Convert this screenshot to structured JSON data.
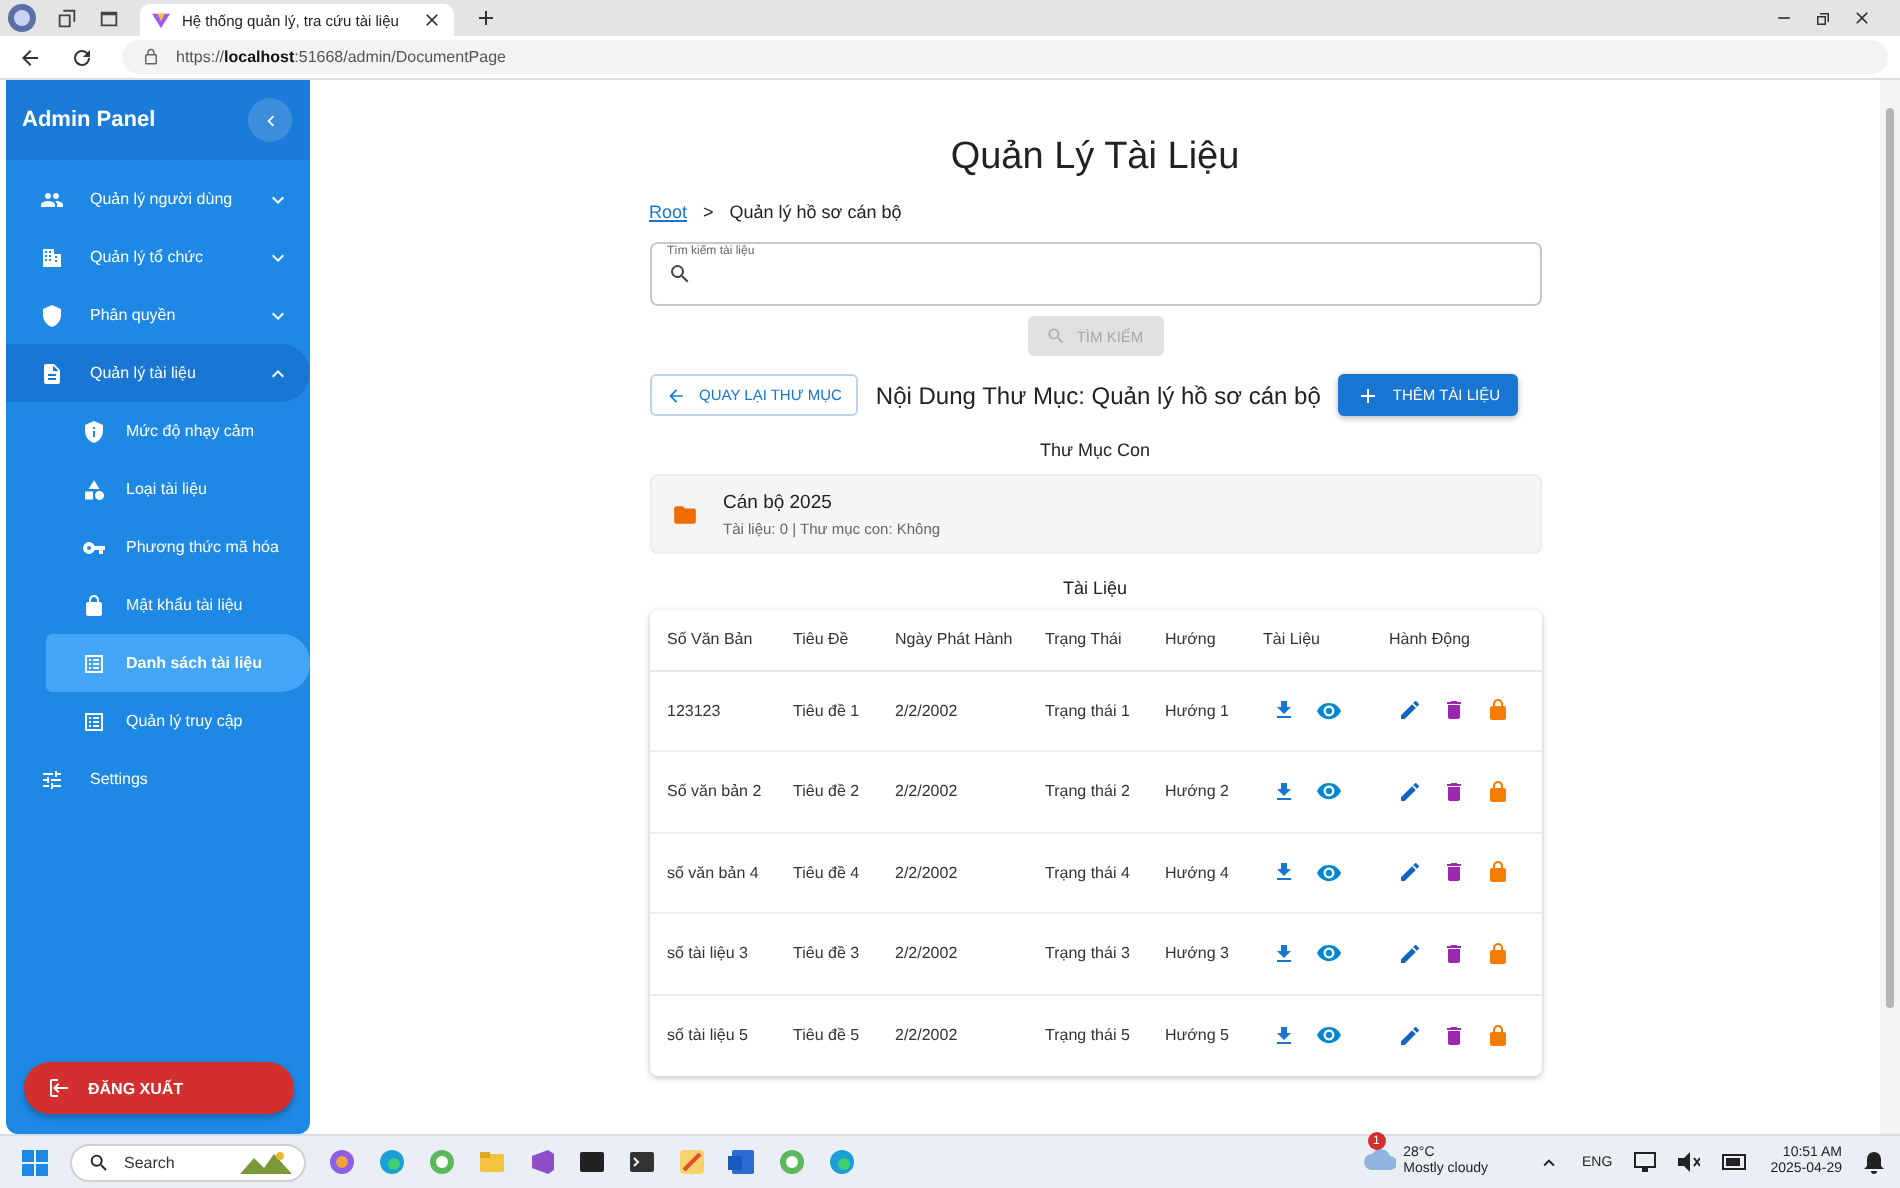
{
  "browser": {
    "tab_title": "Hệ thống quản lý, tra cứu tài liệu",
    "url": "https://**localhost**:51668/admin/DocumentPage"
  },
  "sidebar": {
    "title": "Admin Panel",
    "items": [
      {
        "label": "Quản lý người dùng",
        "kind": "group",
        "expanded": false,
        "selected": false
      },
      {
        "label": "Quản lý tổ chức",
        "kind": "group",
        "expanded": false,
        "selected": false
      },
      {
        "label": "Phân quyền",
        "kind": "group",
        "expanded": false,
        "selected": false
      },
      {
        "label": "Quản lý tài liệu",
        "kind": "group",
        "expanded": true,
        "selected": false,
        "children": [
          {
            "label": "Mức độ nhạy cảm",
            "selected": false
          },
          {
            "label": "Loại tài liệu",
            "selected": false
          },
          {
            "label": "Phương thức mã hóa",
            "selected": false
          },
          {
            "label": "Mật khẩu tài liệu",
            "selected": false
          },
          {
            "label": "Danh sách tài liệu",
            "selected": true
          },
          {
            "label": "Quản lý truy cập",
            "selected": false
          }
        ]
      },
      {
        "label": "Settings",
        "kind": "link",
        "selected": false
      }
    ],
    "logout": "ĐĂNG XUẤT"
  },
  "page": {
    "title": "Quản Lý Tài Liệu",
    "breadcrumb": [
      "Root",
      "Quản lý hồ sơ cán bộ"
    ],
    "breadcrumb_separator": ">",
    "search": {
      "label": "Tìm kiếm tài liệu",
      "button": "TÌM KIẾM",
      "disabled": true
    },
    "back_button": "QUAY LẠI THƯ MỤC",
    "folder_heading": "Nội Dung Thư Mục: Quản lý hồ sơ cán bộ",
    "add_button": "THÊM TÀI LIỆU",
    "subfolders_title": "Thư Mục Con",
    "subfolders": [
      {
        "name": "Cán bộ 2025",
        "info": "Tài liệu: 0 | Thư mục con: Không"
      }
    ],
    "documents_title": "Tài Liệu",
    "table": {
      "columns": [
        "Số Văn Bản",
        "Tiêu Đề",
        "Ngày Phát Hành",
        "Trạng Thái",
        "Hướng",
        "Tài Liệu",
        "Hành Động"
      ],
      "rows": [
        {
          "cells": [
            "123123",
            "Tiêu đề 1",
            "2/2/2002",
            "Trạng thái 1",
            "Hướng 1"
          ]
        },
        {
          "cells": [
            "Số văn bản 2",
            "Tiêu đề 2",
            "2/2/2002",
            "Trạng thái 2",
            "Hướng 2"
          ]
        },
        {
          "cells": [
            "số văn bản 4",
            "Tiêu đề 4",
            "2/2/2002",
            "Trạng thái 4",
            "Hướng 4"
          ]
        },
        {
          "cells": [
            "số tài liệu 3",
            "Tiêu đề 3",
            "2/2/2002",
            "Trạng thái 3",
            "Hướng 3"
          ]
        },
        {
          "cells": [
            "số tài liệu 5",
            "Tiêu đề 5",
            "2/2/2002",
            "Trạng thái 5",
            "Hướng 5"
          ]
        }
      ]
    }
  },
  "taskbar": {
    "search_placeholder": "Search",
    "weather": {
      "temperature": "28°C",
      "condition": "Mostly cloudy",
      "badge": "1"
    },
    "language": "ENG",
    "time": "10:51 AM",
    "date": "2025-04-29"
  }
}
